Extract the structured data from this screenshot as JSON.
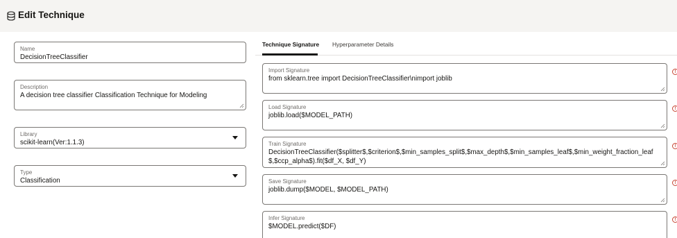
{
  "header": {
    "title": "Edit Technique",
    "icon": "database-icon"
  },
  "left": {
    "name": {
      "label": "Name",
      "value": "DecisionTreeClassifier"
    },
    "description": {
      "label": "Description",
      "value": "A decision tree classifier Classification Technique for Modeling"
    },
    "library": {
      "label": "Library",
      "value": "scikit-learn(Ver:1.1.3)"
    },
    "type": {
      "label": "Type",
      "value": "Classification"
    }
  },
  "tabs": [
    {
      "label": "Technique Signature",
      "active": true
    },
    {
      "label": "Hyperparameter Details",
      "active": false
    }
  ],
  "signatures": [
    {
      "label": "Import Signature",
      "value": "from sklearn.tree import DecisionTreeClassifier\\nimport joblib"
    },
    {
      "label": "Load Signature",
      "value": "joblib.load($MODEL_PATH)"
    },
    {
      "label": "Train Signature",
      "value": "DecisionTreeClassifier($splitter$,$criterion$,$min_samples_split$,$max_depth$,$min_samples_leaf$,$min_weight_fraction_leaf$,$ccp_alpha$).fit($df_X, $df_Y)"
    },
    {
      "label": "Save Signature",
      "value": "joblib.dump($MODEL, $MODEL_PATH)"
    },
    {
      "label": "Infer Signature",
      "value": "$MODEL.predict($DF)"
    }
  ],
  "colors": {
    "warning": "#c74634",
    "header_bg": "#f5f4f2"
  }
}
